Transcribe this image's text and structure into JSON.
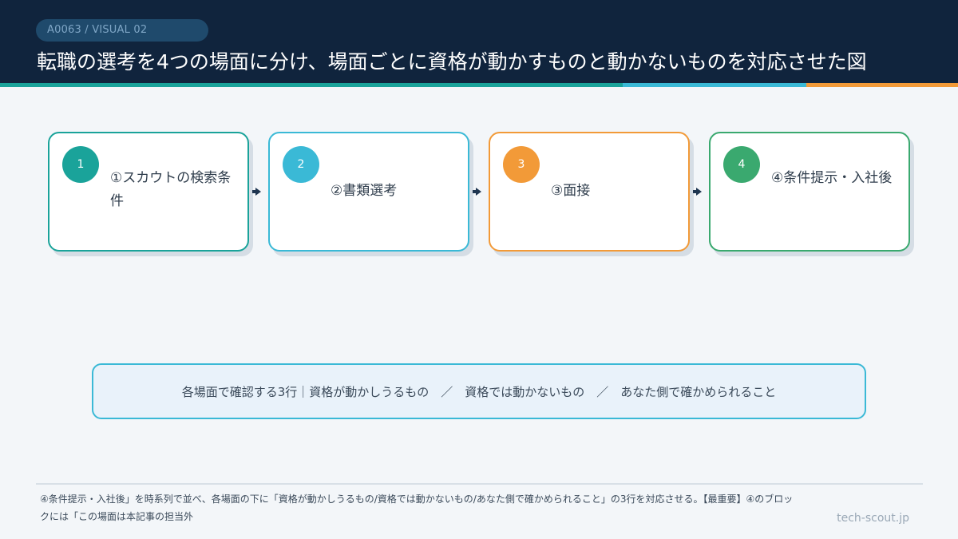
{
  "header": {
    "tag": "A0063 / VISUAL 02",
    "title": "転職の選考を4つの場面に分け、場面ごとに資格が動かすものと動かないものを対応させた図"
  },
  "colors": {
    "header_bg": "#10243d",
    "teal": "#1aa39a",
    "blue": "#3ab9d6",
    "orange": "#f29a38",
    "green": "#3aa96f"
  },
  "steps": [
    {
      "number": "1",
      "label": "①スカウトの検索条件"
    },
    {
      "number": "2",
      "label": "②書類選考"
    },
    {
      "number": "3",
      "label": "③面接"
    },
    {
      "number": "4",
      "label": "④条件提示・入社後"
    }
  ],
  "summary": {
    "text": "各場面で確認する3行｜資格が動かしうるもの　／　資格では動かないもの　／　あなた側で確かめられること"
  },
  "footer": {
    "note": "④条件提示・入社後」を時系列で並べ、各場面の下に「資格が動かしうるもの/資格では動かないもの/あなた側で確かめられること」の3行を対応させる。【最重要】④のブロックには「この場面は本記事の担当外",
    "site": "tech-scout.jp"
  }
}
